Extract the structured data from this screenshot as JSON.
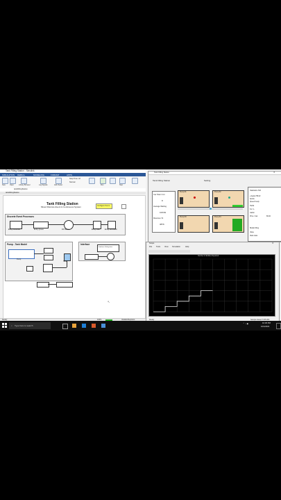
{
  "simulink": {
    "window_title": "Tank Filling Station - Simulink",
    "tabs": [
      "SIMULATION",
      "DEBUG",
      "MODELING",
      "FORMAT",
      "APPS"
    ],
    "toolbar": [
      "New",
      "Open",
      "Save",
      "Print",
      "Library Browser",
      "Log Signals",
      "Add Viewer",
      "Stop Time",
      "Normal",
      "Step Back",
      "Run",
      "Step Fwd",
      "Stop",
      "Data Inspector"
    ],
    "stop_time": "Stop Time: inf",
    "path": "tankFillingStation",
    "tab_strip": "tankFillingStation",
    "model_title": "Tank Filling Station",
    "model_subtitle": "Mixed Discrete Event & Continuous System",
    "configure_button": "Configure Demo",
    "discrete_label": "Discrete Event Processes",
    "pump_label": "Pump - Tank Model",
    "interface_label": "Interface",
    "blocks": {
      "generator": "Entity Generator",
      "queue": "Entity Queue",
      "server": "Fill Station",
      "gate": "Entity Gate",
      "terminator": "Entity Terminator",
      "pump": "Pump",
      "tank": "Tank",
      "interface_block": "Interface Subsystem",
      "interface_queue": "Queue",
      "interface_server": "Server"
    },
    "status_left": "Ready",
    "status_zoom": "100%",
    "status_right": "VariableStepAuto"
  },
  "animation": {
    "title": "Tank Filling Station",
    "panel_title": "Tank Filling Station",
    "setting_label": "Setting",
    "car_label": "Car Total / Cnt",
    "car_value": "8",
    "avg_label": "Average Waiting",
    "avg_value": "0.8152",
    "revenue_label": "Revenue / $",
    "revenue_value": "3876",
    "stations": [
      "Pump #1",
      "Pump #2",
      "Pump #3",
      "Pump #4"
    ],
    "stats_title": "Statistics NO",
    "stats_lines": [
      "e Apple HB-02",
      "Spotle",
      "Speed Fuelp",
      "TEVE",
      "8.2 / L",
      "Gallon",
      "Price / Gal"
    ],
    "stats_value": "86.00",
    "stats_footer": [
      "Model Ring",
      "Value",
      "Stats stats"
    ]
  },
  "scope": {
    "title": "Scope",
    "menu": [
      "File",
      "Tools",
      "View",
      "Simulation",
      "Help"
    ],
    "plot_title": "Number of Entities Departed",
    "status_left": "Ready",
    "status_right": "Sample based  T=65.000",
    "chart_data": {
      "type": "line",
      "x": [
        0,
        5,
        10,
        15,
        20,
        25,
        30,
        35,
        40,
        45,
        50
      ],
      "y": [
        0,
        0,
        1,
        1,
        2,
        2,
        3,
        3,
        4,
        4,
        4
      ],
      "xlim": [
        0,
        100
      ],
      "ylim": [
        0,
        10
      ],
      "grid": true
    }
  },
  "taskbar": {
    "search": "Type here to search",
    "time": "10:36 PM",
    "date": "10/4/2021"
  }
}
